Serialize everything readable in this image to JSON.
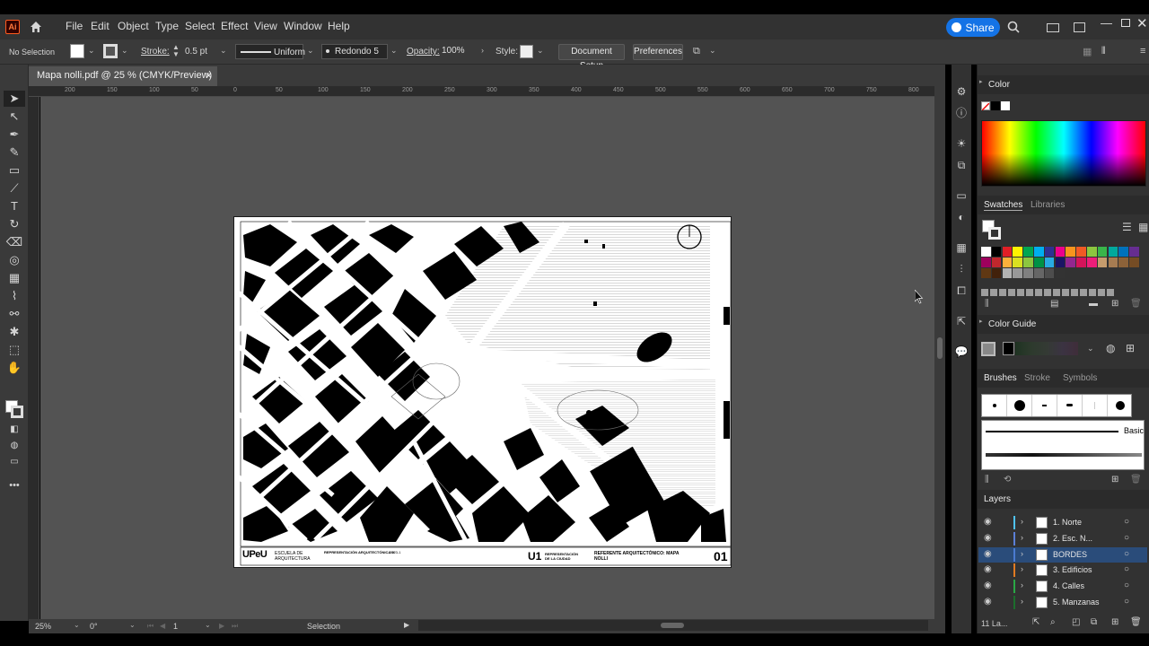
{
  "app": {
    "logo": "Ai"
  },
  "menu": [
    "File",
    "Edit",
    "Object",
    "Type",
    "Select",
    "Effect",
    "View",
    "Window",
    "Help"
  ],
  "share_label": "Share",
  "control": {
    "selection": "No Selection",
    "stroke_label": "Stroke:",
    "stroke_value": "0.5 pt",
    "profile": "Uniform",
    "brush": "Redondo 5 ...",
    "opacity_label": "Opacity:",
    "opacity_value": "100%",
    "style_label": "Style:",
    "doc_setup": "Document Setup",
    "preferences": "Preferences"
  },
  "tab": {
    "title": "Mapa nolli.pdf @ 25 % (CMYK/Preview)",
    "close": "×"
  },
  "ruler": {
    "ticks": [
      "200",
      "150",
      "100",
      "50",
      "0",
      "50",
      "100",
      "150",
      "200",
      "250",
      "300",
      "350",
      "400",
      "450",
      "500",
      "550",
      "600",
      "650",
      "700",
      "750",
      "800"
    ]
  },
  "titleblock": {
    "logo": "UPeU",
    "school": "ESCUELA DE ARQUITECTURA",
    "course": "REPRESENTACIÓN ARQUITECTÓNICA III",
    "year": "2023-1",
    "unit": "U1",
    "unit_desc": "REPRESENTACIÓN DE LA CIUDAD",
    "subject": "REFERENTE ARQUITECTÓNICO: MAPA NOLLI",
    "sheet": "01"
  },
  "status": {
    "zoom": "25%",
    "rotation": "0°",
    "artboard": "1",
    "tool": "Selection"
  },
  "panels": {
    "color_title": "Color",
    "swatches_tab": "Swatches",
    "libraries_tab": "Libraries",
    "color_guide_title": "Color Guide",
    "brushes_tab": "Brushes",
    "stroke_tab": "Stroke",
    "symbols_tab": "Symbols",
    "brush_basic": "Basic",
    "layers_title": "Layers",
    "layers_count": "11 La..."
  },
  "layers": [
    {
      "name": "1. Norte",
      "color": "#4fc3f7"
    },
    {
      "name": "2. Esc. N...",
      "color": "#5b7fd6"
    },
    {
      "name": "BORDES",
      "color": "#4a7bd0",
      "selected": true
    },
    {
      "name": "3. Edificios",
      "color": "#e07b22"
    },
    {
      "name": "4. Calles",
      "color": "#2aa845"
    },
    {
      "name": "5. Manzanas",
      "color": "#1c6e2c"
    }
  ],
  "swatch_colors": [
    "#ffffff",
    "#000000",
    "#e21f26",
    "#fff200",
    "#00a651",
    "#00aeef",
    "#2e3192",
    "#ec008c",
    "#f7941d",
    "#f15a24",
    "#8dc63f",
    "#39b54a",
    "#00a99d",
    "#0072bc",
    "#662d91",
    "#9e005d",
    "#c1272d",
    "#fbb03b",
    "#d9e021",
    "#8cc63f",
    "#009245",
    "#29abe2",
    "#1b1464",
    "#93278f",
    "#d4145a",
    "#ed1e79",
    "#c69c6d",
    "#a67c52",
    "#8c6239",
    "#754c24",
    "#603813",
    "#42210b",
    "#b3b3b3",
    "#999999",
    "#808080",
    "#666666",
    "#4d4d4d",
    "#333333"
  ]
}
